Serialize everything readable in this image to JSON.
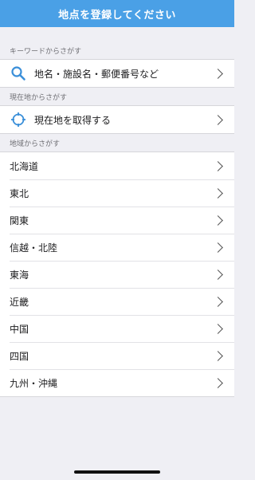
{
  "header": {
    "title": "地点を登録してください"
  },
  "sections": {
    "keyword": {
      "label": "キーワードからさがす",
      "row_label": "地名・施設名・郵便番号など",
      "icon": "search-icon"
    },
    "current": {
      "label": "現在地からさがす",
      "row_label": "現在地を取得する",
      "icon": "crosshair-icon"
    },
    "region": {
      "label": "地域からさがす",
      "items": [
        "北海道",
        "東北",
        "関東",
        "信越・北陸",
        "東海",
        "近畿",
        "中国",
        "四国",
        "九州・沖縄"
      ]
    }
  },
  "colors": {
    "header": "#4aa0e6",
    "accent": "#3a8fd9",
    "background": "#efeff4"
  }
}
